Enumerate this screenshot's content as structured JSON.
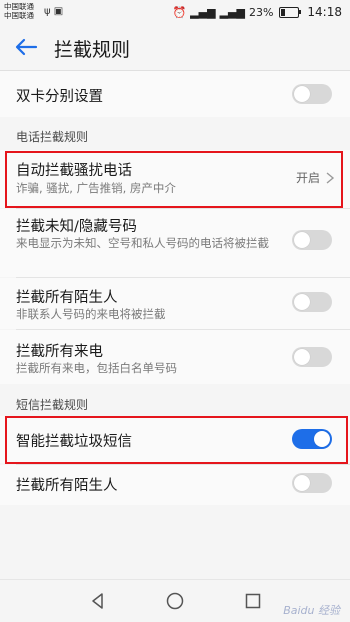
{
  "status_bar": {
    "carrier1": "中国联通",
    "carrier2": "中国联通",
    "battery_text": "23%",
    "battery_level": 0.23,
    "time": "14:18"
  },
  "header": {
    "back_icon": "arrow-left-icon",
    "title": "拦截规则"
  },
  "dual_sim": {
    "label": "双卡分别设置",
    "enabled": false
  },
  "call_section": {
    "label": "电话拦截规则",
    "items": [
      {
        "title": "自动拦截骚扰电话",
        "subtitle": "诈骗, 骚扰, 广告推销, 房产中介",
        "value": "开启",
        "highlighted": true
      },
      {
        "title": "拦截未知/隐藏号码",
        "subtitle": "来电显示为未知、空号和私人号码的电话将被拦截",
        "enabled": false
      },
      {
        "title": "拦截所有陌生人",
        "subtitle": "非联系人号码的来电将被拦截",
        "enabled": false
      },
      {
        "title": "拦截所有来电",
        "subtitle": "拦截所有来电，包括白名单号码",
        "enabled": false
      }
    ]
  },
  "sms_section": {
    "label": "短信拦截规则",
    "items": [
      {
        "title": "智能拦截垃圾短信",
        "enabled": true,
        "highlighted": true
      },
      {
        "title": "拦截所有陌生人",
        "enabled": false
      }
    ]
  },
  "nav": {
    "back": "triangle-back-icon",
    "home": "circle-home-icon",
    "recents": "square-recents-icon"
  },
  "watermark": "Baidu 经验",
  "colors": {
    "accent": "#1e6ee8",
    "highlight": "#e5151c",
    "toggle_off": "#d8d8d8"
  }
}
